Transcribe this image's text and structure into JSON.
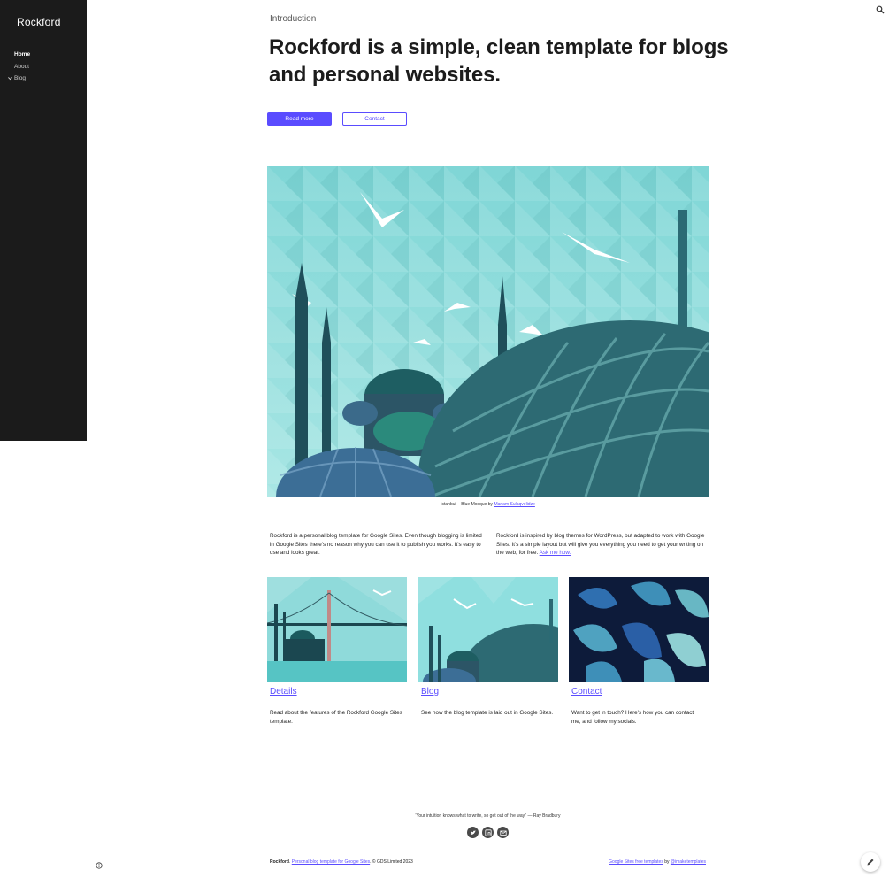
{
  "site": {
    "title": "Rockford"
  },
  "nav": {
    "items": [
      {
        "label": "Home",
        "active": true
      },
      {
        "label": "About",
        "active": false
      },
      {
        "label": "Blog",
        "active": false,
        "expandable": true
      }
    ]
  },
  "header": {
    "kicker": "Introduction",
    "headline": "Rockford is a simple, clean template for blogs and personal websites.",
    "read_more_label": "Read more",
    "contact_label": "Contact"
  },
  "hero": {
    "caption_text": "Istanbul – Blue Mosque by ",
    "caption_link": "Mariam Sulaqvelidze"
  },
  "intro": {
    "left": "Rockford is a personal blog template for Google Sites. Even though blogging is limited in Google Sites there's no reason why you can use it to publish you works. It's easy to use and looks great.",
    "right_text": "Rockford is inspired by blog themes for WordPress, but adapted to work with Google Sites. It's a simple layout but will give you everything you need to get your writing on the web, for free. ",
    "right_link": "Ask me how."
  },
  "cards": [
    {
      "title": "Details",
      "text": "Read about the features of the Rockford Google Sites template."
    },
    {
      "title": "Blog",
      "text": "See how the blog template is laid out in Google Sites."
    },
    {
      "title": "Contact",
      "text": "Want to get in touch? Here's how you can contact me, and follow my socials."
    }
  ],
  "footer": {
    "quote": "'Your intuition knows what to write, so get out of the way.'  — Ray Bradbury",
    "brand": "Rockford",
    "left_link": "Personal blog template for Google Sites",
    "left_suffix": ". © GDS Limited 2023",
    "right_link1": "Google Sites free templates",
    "right_by": " by ",
    "right_link2": "@imaketemplates"
  },
  "colors": {
    "accent": "#5a4cff",
    "sidebar_bg": "#1b1b1b",
    "teal_light": "#8fdfdf",
    "teal_dark": "#2d6a73"
  }
}
